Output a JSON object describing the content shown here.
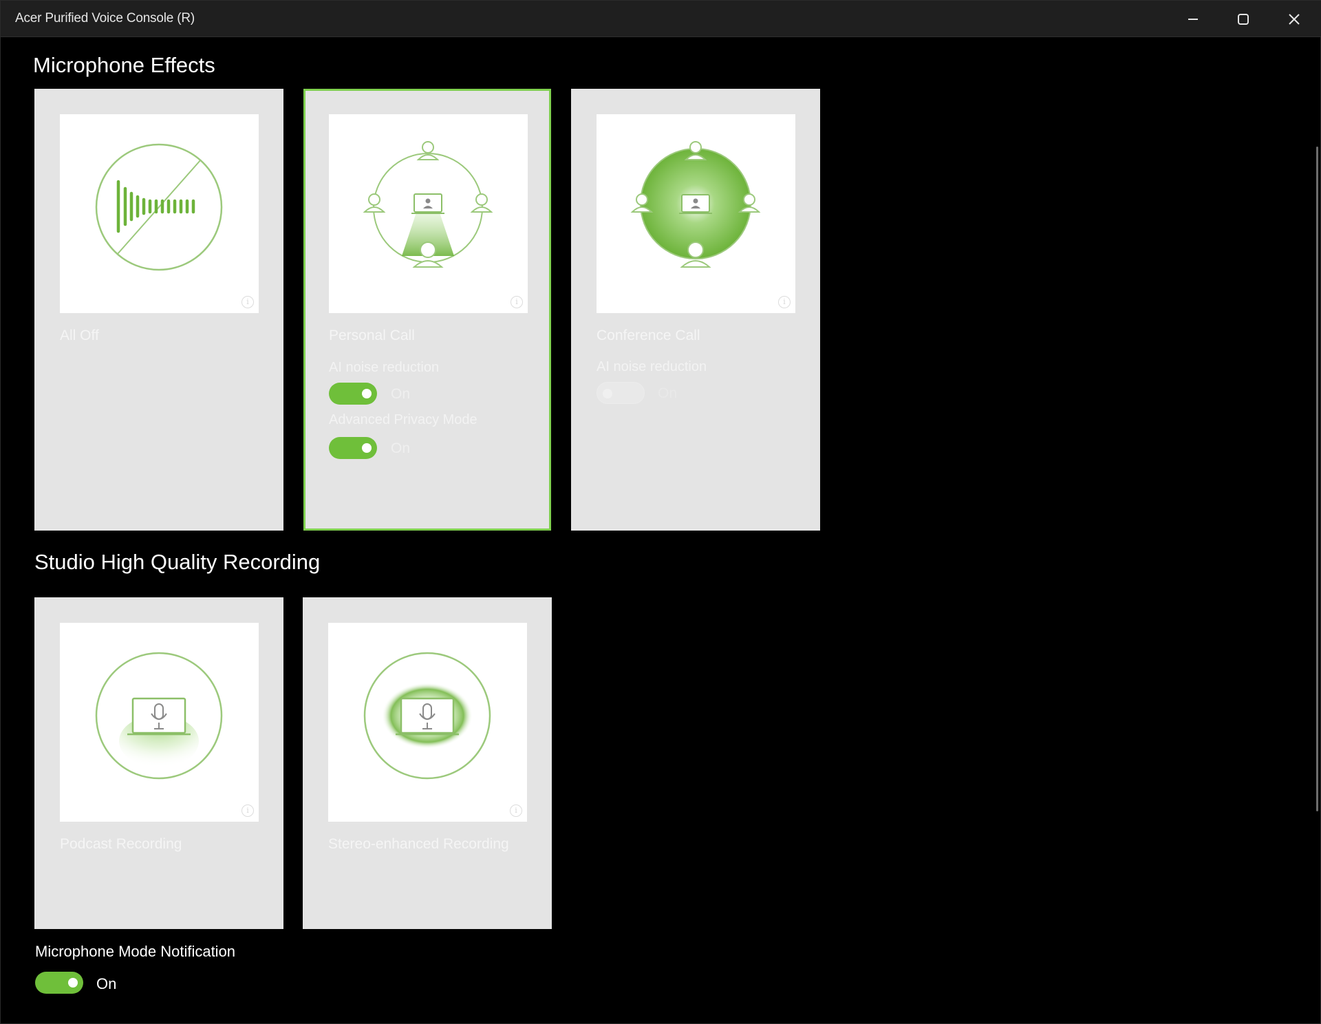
{
  "window": {
    "title": "Acer Purified Voice Console (R)",
    "controls": {
      "minimize": "minimize-icon",
      "maximize": "maximize-icon",
      "close": "close-icon"
    }
  },
  "microphone_effects": {
    "title": "Microphone Effects",
    "cards": [
      {
        "label": "All Off",
        "icon": "mute-waveform-icon",
        "selected": false
      },
      {
        "label": "Personal Call",
        "icon": "personal-call-icon",
        "selected": true,
        "options": [
          {
            "label": "AI noise reduction",
            "state": "On",
            "on": true
          },
          {
            "label": "Advanced Privacy Mode",
            "state": "On",
            "on": true
          }
        ]
      },
      {
        "label": "Conference Call",
        "icon": "conference-call-icon",
        "selected": false,
        "options": [
          {
            "label": "AI noise reduction",
            "state": "On",
            "on": false,
            "disabled": true
          }
        ]
      }
    ]
  },
  "studio_recording": {
    "title": "Studio High Quality Recording",
    "cards": [
      {
        "label": "Podcast Recording",
        "icon": "podcast-recording-icon",
        "selected": false
      },
      {
        "label": "Stereo-enhanced Recording",
        "icon": "stereo-recording-icon",
        "selected": false
      }
    ]
  },
  "notification": {
    "label": "Microphone Mode Notification",
    "state": "On",
    "on": true
  },
  "colors": {
    "accent": "#6fbf3a",
    "selected_border": "#7fd04e",
    "card_bg": "#e4e4e4",
    "window_bg": "#000000",
    "titlebar_bg": "#1f1f1f"
  }
}
